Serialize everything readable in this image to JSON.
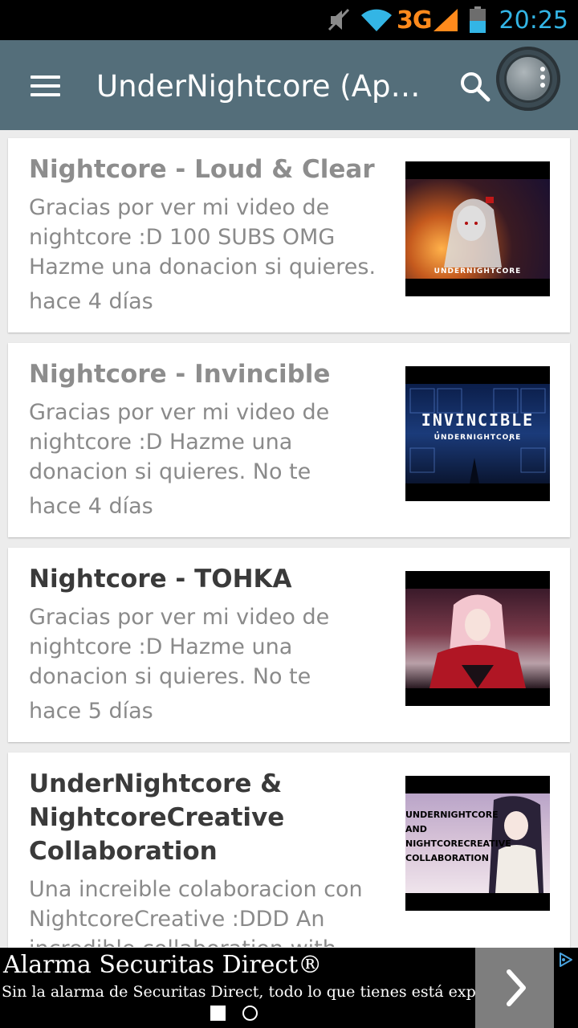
{
  "status_bar": {
    "network": "3G",
    "time": "20:25"
  },
  "app_bar": {
    "title": "UnderNightcore (App…",
    "menu_icon": "hamburger-menu-icon",
    "search_icon": "search-icon",
    "overflow_icon": "overflow-menu-icon"
  },
  "videos": [
    {
      "title": "Nightcore - Loud & Clear",
      "description": "Gracias por ver mi video de nightcore :D 100 SUBS OMG Hazme una donacion si quieres.",
      "date": "hace 4 días",
      "thumb_caption": "UNDERNIGHTCORE"
    },
    {
      "title": "Nightcore - Invincible",
      "description": "Gracias por ver mi video de nightcore :D Hazme una donacion si quieres. No te",
      "date": "hace 4 días",
      "thumb_caption": "UNDERNIGHTCORE",
      "thumb_title": "INVINCIBLE"
    },
    {
      "title": "Nightcore - TOHKA",
      "description": "Gracias por ver mi video de nightcore :D Hazme una donacion si quieres. No te",
      "date": "hace 5 días"
    },
    {
      "title": "UnderNightcore & NightcoreCreative Collaboration",
      "description": "Una increible colaboracion con NightcoreCreative :DDD An incredible collaboration with",
      "thumb_lines": [
        "UNDERNIGHTCORE",
        "AND",
        "NIGHTCORECREATIVE",
        "COLLABORATION"
      ]
    }
  ],
  "ad": {
    "title": "Alarma Securitas Direct®",
    "text": "Sin la alarma de Securitas Direct, todo lo que tienes está expuesto.",
    "arrow_icon": "chevron-right-icon",
    "choices_icon": "adchoices-icon"
  },
  "colors": {
    "app_bar": "#546e7a",
    "time": "#33b5e5",
    "network": "#ff8a1c",
    "visited_title": "#8d8d8d",
    "unvisited_title": "#3a3a3a"
  }
}
